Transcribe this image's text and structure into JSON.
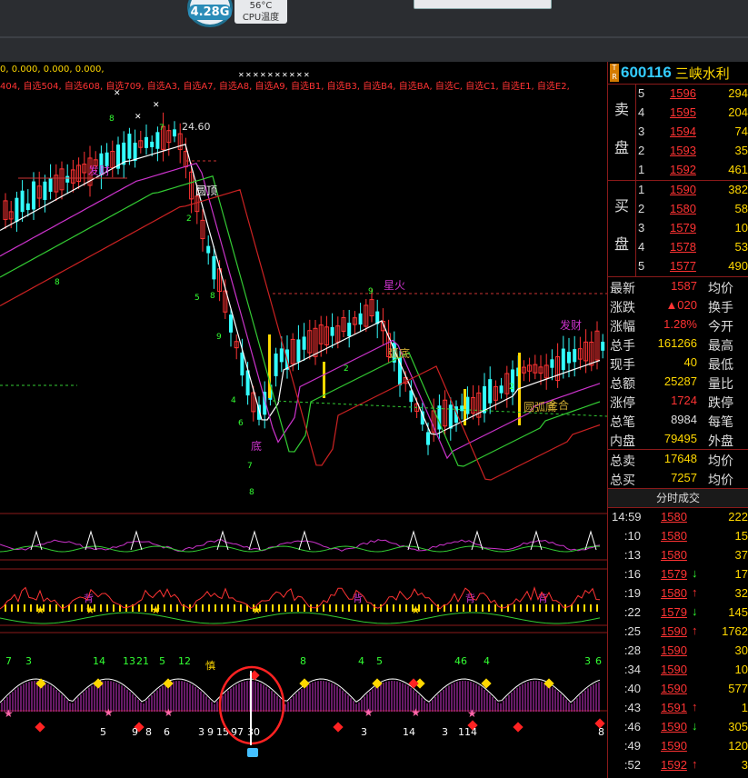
{
  "topbar": {
    "gauge_value": "4.28G",
    "cpu_temp": "56°C",
    "cpu_label": "CPU温度"
  },
  "chart": {
    "indicator_values": "0, 0.000, 0.000, 0.000,",
    "watchlist_tabs": "404, 自选504, 自选608, 自选709, 自选A3, 自选A7, 自选A8, 自选A9, 自选B1, 自选B3, 自选B4, 自选BA, 自选C, 自选C1, 自选E1, 自选E2,",
    "annotations": {
      "high_price": "24.60",
      "yuan_ding": "圆顶",
      "fa_cai": "发财",
      "xing_huo": "星火",
      "hu_di": "弧底",
      "di": "底",
      "yuan_hu_di": "圆弧底",
      "jin_he": "金合",
      "fa_cai_right": "发财",
      "bei": "背",
      "shen": "慎"
    },
    "panel3_numbers": [
      "7",
      "3",
      "14",
      "13",
      "21",
      "5",
      "12",
      "8",
      "4",
      "5",
      "46",
      "4",
      "3",
      "6"
    ],
    "panel3_bottom_numbers": [
      "5",
      "9",
      "8",
      "6",
      "3",
      "9",
      "15",
      "97",
      "30",
      "3",
      "14",
      "3",
      "114",
      "8"
    ],
    "colors": {
      "up": "#ff3333",
      "down": "#33ffff",
      "ma_white": "#ffffff",
      "ma_purple": "#cc33cc",
      "ma_green": "#33cc33",
      "ma_red": "#cc2222"
    }
  },
  "quote": {
    "code": "600116",
    "name": "三峡水利",
    "sell_label": [
      "卖",
      "盘"
    ],
    "buy_label": [
      "买",
      "盘"
    ],
    "sell_orders": [
      {
        "level": "5",
        "price": "1596",
        "vol": "294"
      },
      {
        "level": "4",
        "price": "1595",
        "vol": "204"
      },
      {
        "level": "3",
        "price": "1594",
        "vol": "74"
      },
      {
        "level": "2",
        "price": "1593",
        "vol": "35"
      },
      {
        "level": "1",
        "price": "1592",
        "vol": "461"
      }
    ],
    "buy_orders": [
      {
        "level": "1",
        "price": "1590",
        "vol": "382"
      },
      {
        "level": "2",
        "price": "1580",
        "vol": "58"
      },
      {
        "level": "3",
        "price": "1579",
        "vol": "10"
      },
      {
        "level": "4",
        "price": "1578",
        "vol": "53"
      },
      {
        "level": "5",
        "price": "1577",
        "vol": "490"
      }
    ],
    "stats": [
      {
        "label": "最新",
        "value": "1587",
        "color": "#ff3333",
        "right": "均价"
      },
      {
        "label": "涨跌",
        "value": "▲020",
        "color": "#ff3333",
        "right": "换手"
      },
      {
        "label": "涨幅",
        "value": "1.28%",
        "color": "#ff3333",
        "right": "今开"
      },
      {
        "label": "总手",
        "value": "161266",
        "color": "#ffd800",
        "right": "最高"
      },
      {
        "label": "现手",
        "value": "40",
        "color": "#ffd800",
        "right": "最低"
      },
      {
        "label": "总额",
        "value": "25287",
        "color": "#ffd800",
        "right": "量比"
      },
      {
        "label": "涨停",
        "value": "1724",
        "color": "#ff3333",
        "right": "跌停"
      },
      {
        "label": "总笔",
        "value": "8984",
        "color": "#ddd",
        "right": "每笔"
      },
      {
        "label": "内盘",
        "value": "79495",
        "color": "#ffd800",
        "right": "外盘"
      }
    ],
    "totals": [
      {
        "label": "总卖",
        "value": "17648",
        "right": "均价"
      },
      {
        "label": "总买",
        "value": "7257",
        "right": "均价"
      }
    ],
    "ticks_title": "分时成交",
    "ticks": [
      {
        "time": "14:59",
        "price": "1580",
        "arrow": "",
        "vol": "222"
      },
      {
        "time": ":10",
        "price": "1580",
        "arrow": "",
        "vol": "15"
      },
      {
        "time": ":13",
        "price": "1580",
        "arrow": "",
        "vol": "37"
      },
      {
        "time": ":16",
        "price": "1579",
        "arrow": "↓",
        "vol": "17"
      },
      {
        "time": ":19",
        "price": "1580",
        "arrow": "↑",
        "vol": "32"
      },
      {
        "time": ":22",
        "price": "1579",
        "arrow": "↓",
        "vol": "145"
      },
      {
        "time": ":25",
        "price": "1590",
        "arrow": "↑",
        "vol": "1762"
      },
      {
        "time": ":28",
        "price": "1590",
        "arrow": "",
        "vol": "30"
      },
      {
        "time": ":34",
        "price": "1590",
        "arrow": "",
        "vol": "10"
      },
      {
        "time": ":40",
        "price": "1590",
        "arrow": "",
        "vol": "577"
      },
      {
        "time": ":43",
        "price": "1591",
        "arrow": "↑",
        "vol": "1"
      },
      {
        "time": ":46",
        "price": "1590",
        "arrow": "↓",
        "vol": "305"
      },
      {
        "time": ":49",
        "price": "1590",
        "arrow": "",
        "vol": "120"
      },
      {
        "time": ":52",
        "price": "1592",
        "arrow": "↑",
        "vol": "3"
      }
    ]
  }
}
